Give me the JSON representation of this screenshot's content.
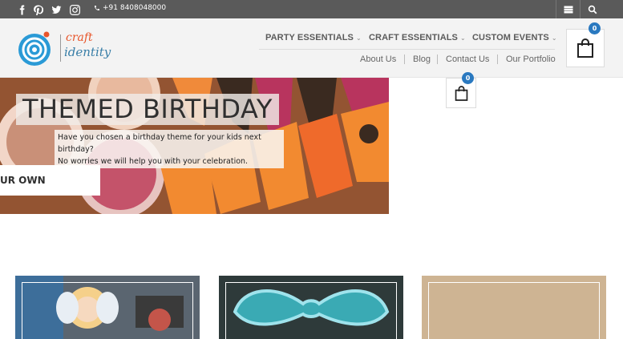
{
  "topbar": {
    "social": [
      "facebook-icon",
      "pinterest-icon",
      "twitter-icon",
      "instagram-icon"
    ],
    "phone": "+91 8408048000"
  },
  "logo": {
    "line1": "craft",
    "line2": "identity"
  },
  "nav": {
    "main": [
      "PARTY ESSENTIALS",
      "CRAFT ESSENTIALS",
      "CUSTOM EVENTS"
    ],
    "sub": [
      "About Us",
      "Blog",
      "Contact Us",
      "Our Portfolio"
    ]
  },
  "cart": {
    "count": "0"
  },
  "hero": {
    "title": "THEMED BIRTHDAY",
    "desc_line1": "Have you chosen a birthday theme for your kids next",
    "desc_line2": "birthday?",
    "desc_line3": "No worries we will help you with your celebration.",
    "button": "UR OWN"
  },
  "colors": {
    "topbar": "#5a5a5a",
    "header": "#f3f3f3",
    "badge": "#2a79c0",
    "nav_text": "#5b5b5b"
  }
}
